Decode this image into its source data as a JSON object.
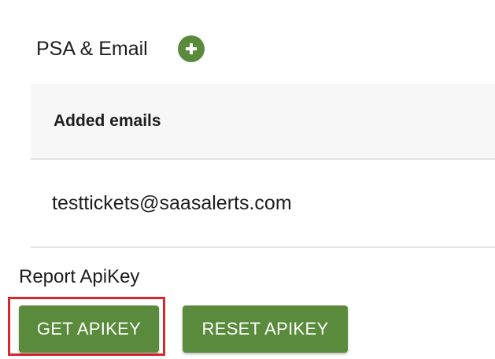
{
  "section": {
    "title": "PSA & Email"
  },
  "emails_table": {
    "header": "Added emails",
    "rows": [
      "testtickets@saasalerts.com"
    ]
  },
  "apikey": {
    "label": "Report ApiKey",
    "get_label": "GET APIKEY",
    "reset_label": "RESET APIKEY"
  },
  "colors": {
    "accent_green": "#5a8a3b",
    "highlight_red": "#d9262c"
  },
  "icons": {
    "add": "plus-circle-icon"
  }
}
